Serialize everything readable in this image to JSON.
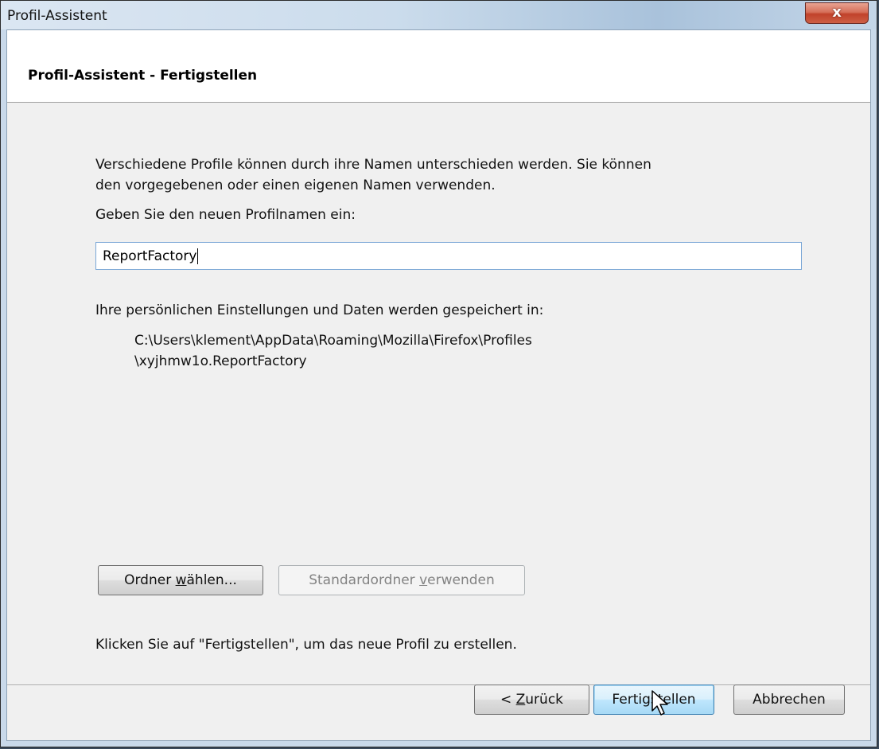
{
  "window": {
    "title": "Profil-Assistent",
    "close_glyph": "x"
  },
  "header": {
    "title": "Profil-Assistent - Fertigstellen"
  },
  "body": {
    "intro_line1": "Verschiedene Profile können durch ihre Namen unterschieden werden. Sie können",
    "intro_line2": "den vorgegebenen oder einen eigenen Namen verwenden.",
    "name_prompt": "Geben Sie den neuen Profilnamen ein:",
    "profile_name_value": "ReportFactory",
    "storage_label": "Ihre persönlichen Einstellungen und Daten werden gespeichert in:",
    "storage_path_line1": "C:\\Users\\klement\\AppData\\Roaming\\Mozilla\\Firefox\\Profiles",
    "storage_path_line2": "\\xyjhmw1o.ReportFactory",
    "choose_folder_prefix": "Ordner ",
    "choose_folder_mnemonic": "w",
    "choose_folder_suffix": "ählen...",
    "default_folder_prefix": "Standardordner ",
    "default_folder_mnemonic": "v",
    "default_folder_suffix": "erwenden",
    "finish_hint": "Klicken Sie auf \"Fertigstellen\", um das neue Profil zu erstellen."
  },
  "footer": {
    "back_prefix": "< ",
    "back_mnemonic": "Z",
    "back_suffix": "urück",
    "finish_label": "Fertigstellen",
    "cancel_label": "Abbrechen"
  },
  "icons": {
    "close": "close-icon",
    "cursor": "mouse-pointer-icon"
  },
  "colors": {
    "default_button_border": "#3c7fb1",
    "close_button": "#c1422b",
    "input_border": "#7aa7d6"
  }
}
